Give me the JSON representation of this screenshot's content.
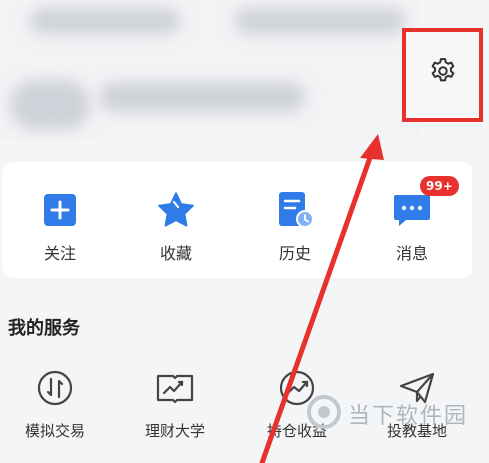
{
  "quick_actions": [
    {
      "label": "关注",
      "icon": "plus-square-icon",
      "color": "#2f7be8"
    },
    {
      "label": "收藏",
      "icon": "star-icon",
      "color": "#2f7be8"
    },
    {
      "label": "历史",
      "icon": "history-document-icon",
      "color": "#2f7be8"
    },
    {
      "label": "消息",
      "icon": "message-icon",
      "color": "#2f7be8",
      "badge": "99+"
    }
  ],
  "services": {
    "title": "我的服务",
    "items": [
      {
        "label": "模拟交易",
        "icon": "simulated-trade-icon"
      },
      {
        "label": "理财大学",
        "icon": "finance-university-icon"
      },
      {
        "label": "持仓收益",
        "icon": "holding-profit-icon"
      },
      {
        "label": "投教基地",
        "icon": "paper-plane-icon"
      }
    ]
  },
  "settings": {
    "icon": "gear-icon",
    "highlight_color": "#e8302c"
  },
  "watermark": {
    "text": "当下软件园"
  },
  "annotation": {
    "arrow_color": "#e8302c"
  }
}
